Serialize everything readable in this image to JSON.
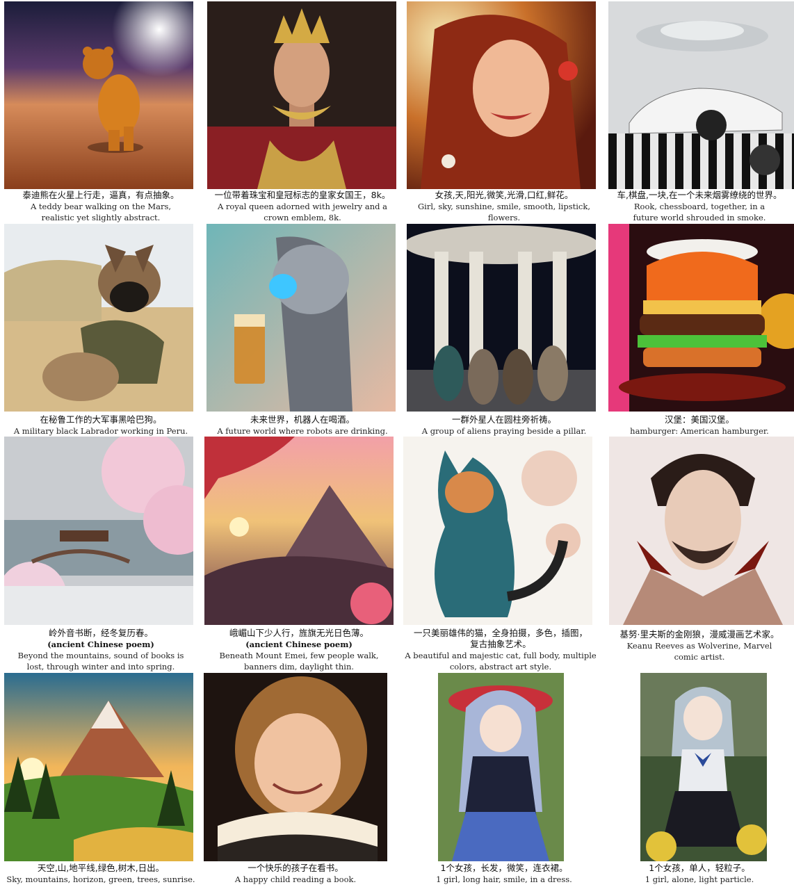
{
  "items": [
    {
      "zh": "泰迪熊在火星上行走，逼真，有点抽象。",
      "en": "A teddy bear walking on the Mars, realistic yet slightly abstract.",
      "icon": "teddy-bear-astronaut-image"
    },
    {
      "zh": "一位带着珠宝和皇冠标志的皇家女国王，8k。",
      "en": "A royal queen adorned with jewelry and a crown emblem, 8k.",
      "icon": "royal-queen-image"
    },
    {
      "zh": "女孩,天,阳光,微笑,光滑,口红,鲜花。",
      "en": "Girl, sky, sunshine, smile, smooth, lipstick, flowers.",
      "icon": "smiling-girl-image"
    },
    {
      "zh": "车,棋盘,一块,在一个未来烟雾缭绕的世界。",
      "en": "Rook, chessboard, together, in a future world shrouded in smoke.",
      "icon": "futuristic-car-image"
    },
    {
      "zh": "在秘鲁工作的大军事黑哈巴狗。",
      "en": "A military black Labrador working in Peru.",
      "icon": "military-dog-image"
    },
    {
      "zh": "未来世界，机器人在喝酒。",
      "en": "A future world where robots are drinking.",
      "icon": "robot-drinking-image"
    },
    {
      "zh": "一群外星人在圆柱旁祈祷。",
      "en": "A group of aliens praying beside a pillar.",
      "icon": "aliens-praying-image"
    },
    {
      "zh": "汉堡：美国汉堡。",
      "en": "hamburger: American hamburger.",
      "icon": "hamburger-image"
    },
    {
      "zh": "岭外音书断，经冬复历春。",
      "note": "(ancient Chinese poem)",
      "en": "Beyond the mountains, sound of books is lost, through winter and into spring.",
      "icon": "snowy-blossom-landscape-image"
    },
    {
      "zh": "峨嵋山下少人行，旌旗无光日色薄。",
      "note": "(ancient Chinese poem)",
      "en": "Beneath Mount Emei, few people walk, banners dim, daylight thin.",
      "icon": "mountain-sunset-image"
    },
    {
      "zh": "一只美丽雄伟的猫，全身拍摄，多色，插图，复古抽象艺术。",
      "en": "A beautiful and majestic cat, full body, multiple colors, abstract art style.",
      "icon": "abstract-cat-image"
    },
    {
      "zh": "基努·里夫斯的金刚狼，漫威漫画艺术家。",
      "en": "Keanu Reeves as Wolverine, Marvel comic artist.",
      "icon": "comic-man-portrait-image"
    },
    {
      "zh": "天空,山,地平线,绿色,树木,日出。",
      "en": "Sky, mountains, horizon, green, trees, sunrise.",
      "icon": "mountain-sunrise-image"
    },
    {
      "zh": "一个快乐的孩子在看书。",
      "en": "A happy child reading a book.",
      "icon": "child-reading-image"
    },
    {
      "zh": "1个女孩，长发，微笑，连衣裙。",
      "en": "1 girl, long hair, smile, in a dress.",
      "icon": "anime-girl-hat-image"
    },
    {
      "zh": "1个女孩，单人，轻粒子。",
      "en": "1 girl, alone, light particle.",
      "icon": "anime-girl-school-image"
    }
  ]
}
